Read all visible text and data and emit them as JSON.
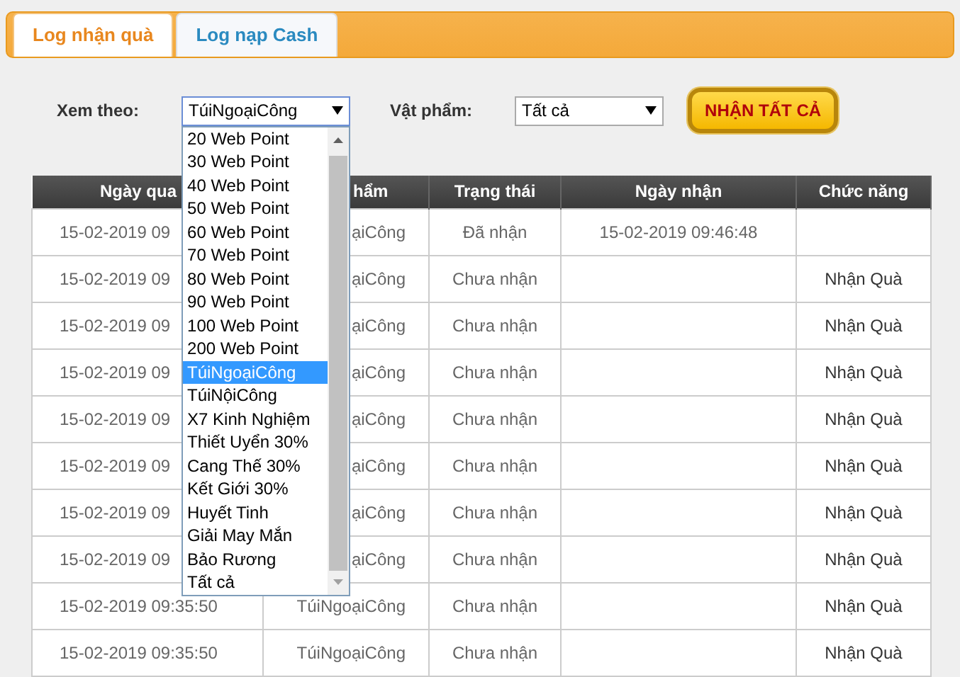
{
  "tabs": [
    {
      "label": "Log nhận quà",
      "selected": true
    },
    {
      "label": "Log nạp Cash",
      "selected": false
    }
  ],
  "filters": [
    {
      "label": "Xem theo:",
      "value": "TúiNgoạiCông",
      "options": [
        {
          "label": "20 Web Point",
          "selected": false
        },
        {
          "label": "30 Web Point",
          "selected": false
        },
        {
          "label": "40 Web Point",
          "selected": false
        },
        {
          "label": "50 Web Point",
          "selected": false
        },
        {
          "label": "60 Web Point",
          "selected": false
        },
        {
          "label": "70 Web Point",
          "selected": false
        },
        {
          "label": "80 Web Point",
          "selected": false
        },
        {
          "label": "90 Web Point",
          "selected": false
        },
        {
          "label": "100 Web Point",
          "selected": false
        },
        {
          "label": "200 Web Point",
          "selected": false
        },
        {
          "label": "TúiNgoạiCông",
          "selected": true
        },
        {
          "label": "TúiNộiCông",
          "selected": false
        },
        {
          "label": "X7 Kinh Nghiệm",
          "selected": false
        },
        {
          "label": "Thiết Uyển 30%",
          "selected": false
        },
        {
          "label": "Cang Thế 30%",
          "selected": false
        },
        {
          "label": "Kết Giới 30%",
          "selected": false
        },
        {
          "label": "Huyết Tinh",
          "selected": false
        },
        {
          "label": "Giải May Mắn",
          "selected": false
        },
        {
          "label": "Bảo Rương",
          "selected": false
        },
        {
          "label": "Tất cả",
          "selected": false
        }
      ]
    },
    {
      "label": "Vật phẩm:",
      "value": "Tất cả"
    }
  ],
  "claim_all_button": "NHẬN TẤT CẢ",
  "table": {
    "columns": [
      "Ngày qua",
      "hẩm",
      "Trạng thái",
      "Ngày nhận",
      "Chức năng"
    ],
    "rows": [
      [
        "15-02-2019 09",
        "ạiCông",
        "Đã nhận",
        "15-02-2019 09:46:48",
        ""
      ],
      [
        "15-02-2019 09",
        "ạiCông",
        "Chưa nhận",
        "",
        "Nhận Quà"
      ],
      [
        "15-02-2019 09",
        "ạiCông",
        "Chưa nhận",
        "",
        "Nhận Quà"
      ],
      [
        "15-02-2019 09",
        "ạiCông",
        "Chưa nhận",
        "",
        "Nhận Quà"
      ],
      [
        "15-02-2019 09",
        "ạiCông",
        "Chưa nhận",
        "",
        "Nhận Quà"
      ],
      [
        "15-02-2019 09",
        "ạiCông",
        "Chưa nhận",
        "",
        "Nhận Quà"
      ],
      [
        "15-02-2019 09",
        "ạiCông",
        "Chưa nhận",
        "",
        "Nhận Quà"
      ],
      [
        "15-02-2019 09",
        "ạiCông",
        "Chưa nhận",
        "",
        "Nhận Quà"
      ],
      [
        "15-02-2019 09:35:50",
        "TúiNgoạiCông",
        "Chưa nhận",
        "",
        "Nhận Quà"
      ],
      [
        "15-02-2019 09:35:50",
        "TúiNgoạiCông",
        "Chưa nhận",
        "",
        "Nhận Quà"
      ]
    ]
  }
}
